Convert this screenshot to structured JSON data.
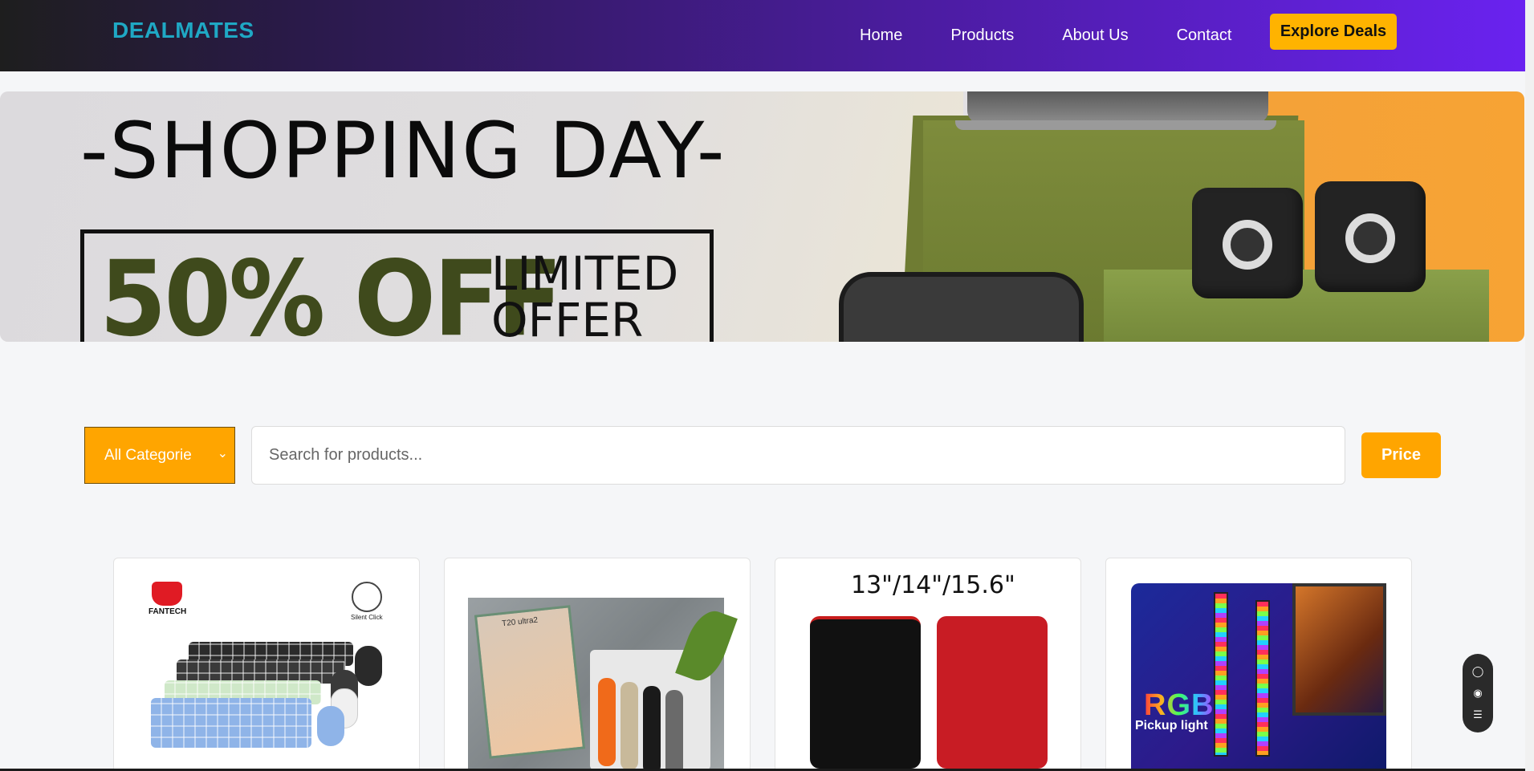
{
  "header": {
    "brand": "DEALMATES",
    "nav": [
      "Home",
      "Products",
      "About Us",
      "Contact"
    ],
    "cta": "Explore Deals"
  },
  "banner": {
    "title": "-SHOPPING DAY-",
    "discount": "50% OFF",
    "limited_line1": "LIMITED",
    "limited_line2": "OFFER"
  },
  "search": {
    "category_value": "All Categorie",
    "placeholder": "Search for products...",
    "price_button": "Price"
  },
  "products": [
    {
      "brand_logo": "FANTECH",
      "badge": "Silent Click"
    },
    {
      "box_label": "T20 ultra2"
    },
    {
      "sizes": "13\"/14\"/15.6\""
    },
    {
      "title": "RGB",
      "subtitle": "Pickup light"
    }
  ],
  "colors": {
    "brand": "#1fa8c4",
    "accent": "#ffa500",
    "nav_gradient_end": "#6a22f0"
  },
  "icons": [
    "chat-icon",
    "settings-icon",
    "list-icon"
  ]
}
